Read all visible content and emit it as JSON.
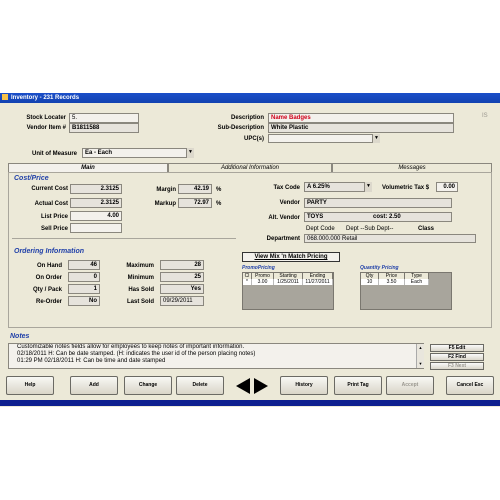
{
  "window": {
    "title": "Inventory - 231 Records"
  },
  "header": {
    "stock_locator_label": "Stock Locater",
    "stock_locator_value": "5.",
    "vendor_item_label": "Vendor Item #",
    "vendor_item_value": "B1811588",
    "description_label": "Description",
    "description_value": "Name Badges",
    "sub_description_label": "Sub-Description",
    "sub_description_value": "White Plastic",
    "upc_label": "UPC(s)",
    "upc_value": "",
    "unit_label": "Unit of Measure",
    "unit_value": "Ea    - Each",
    "corner_mark": "IS"
  },
  "tabs": [
    {
      "label": "Main"
    },
    {
      "label": "Additional Information"
    },
    {
      "label": "Messages"
    }
  ],
  "cost_price": {
    "title": "Cost/Price",
    "current_cost_label": "Current Cost",
    "current_cost_value": "2.3125",
    "actual_cost_label": "Actual Cost",
    "actual_cost_value": "2.3125",
    "list_price_label": "List Price",
    "list_price_value": "4.00",
    "sell_price_label": "Sell Price",
    "sell_price_value": "",
    "margin_label": "Margin",
    "margin_value": "42.19",
    "markup_label": "Markup",
    "markup_value": "72.97",
    "percent": "%"
  },
  "tax_vendor": {
    "tax_code_label": "Tax Code",
    "tax_code_value": "A 6.25%",
    "volumetric_label": "Volumetric Tax $",
    "volumetric_value": "0.00",
    "vendor_label": "Vendor",
    "vendor_value": "PARTY",
    "alt_vendor_label": "Alt. Vendor",
    "alt_vendor_value": "TOYS",
    "alt_cost_label": "cost: 2.50",
    "dept_code_hdr": "Dept Code",
    "dept_sub_hdr": "Dept --Sub Dept--",
    "class_hdr": "Class",
    "department_label": "Department",
    "department_value": "068.000.000 Retail"
  },
  "ordering": {
    "title": "Ordering Information",
    "on_hand_label": "On Hand",
    "on_hand_value": "46",
    "on_order_label": "On Order",
    "on_order_value": "0",
    "qty_pack_label": "Qty / Pack",
    "qty_pack_value": "1",
    "reorder_label": "Re-Order",
    "reorder_value": "No",
    "maximum_label": "Maximum",
    "maximum_value": "28",
    "minimum_label": "Minimum",
    "minimum_value": "25",
    "has_sold_label": "Has Sold",
    "has_sold_value": "Yes",
    "last_sold_label": "Last Sold",
    "last_sold_value": "09/29/2011"
  },
  "mix_match_button": "View Mix 'n Match Pricing",
  "promo": {
    "title": "PromoPricing",
    "headers": [
      "Cl",
      "Promo",
      "Starting",
      "Ending"
    ],
    "row": [
      "*",
      "3.00",
      "1/25/2011",
      "11/27/2011"
    ]
  },
  "quantity": {
    "title": "Quantity Pricing",
    "headers": [
      "Qty",
      "Price",
      "Type"
    ],
    "row": [
      "10",
      "3.50",
      "Each"
    ]
  },
  "notes": {
    "title": "Notes",
    "lines": [
      "Customizable notes fields allow for employees to keep notes of important information.",
      "02/18/2011 H: Can be date stamped. (H: indicates the user id of the person placing notes)",
      "01:29 PM 02/18/2011 H: Can be time and date stamped"
    ]
  },
  "fkeys": {
    "f5": "F5 Edit",
    "f2": "F2 Find",
    "f3": "F3 Next"
  },
  "buttons": {
    "help": "Help",
    "add": "Add",
    "change": "Change",
    "delete": "Delete",
    "history": "History",
    "print_tag": "Print Tag",
    "accept": "Accept",
    "cancel": "Cancel Esc"
  },
  "colors": {
    "title_bar": "#1b4fc9",
    "section_title": "#1f3fa8",
    "description_text": "#d0021b",
    "bottom_band": "#0e1f8f"
  }
}
